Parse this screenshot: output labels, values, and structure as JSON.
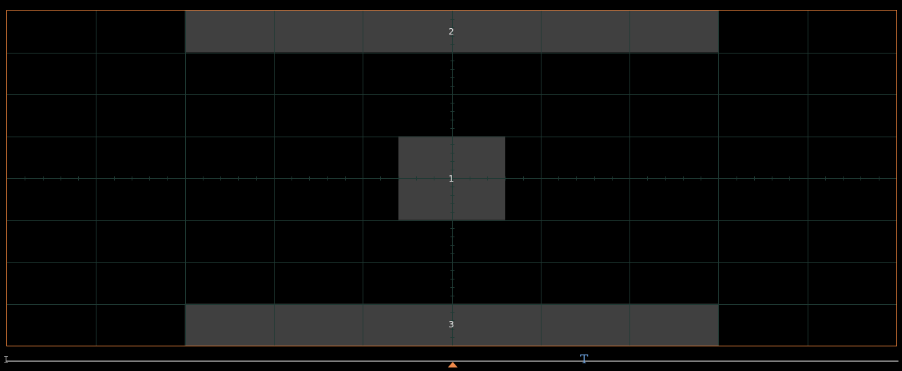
{
  "zones": {
    "zone1": {
      "label": "1"
    },
    "zone2": {
      "label": "2"
    },
    "zone3": {
      "label": "3"
    }
  },
  "timebase": {
    "left_marker": "I",
    "trigger_marker": "T"
  },
  "colors": {
    "border": "#e8803a",
    "grid": "#1f3a34",
    "zone_fill": "#404040",
    "trigger_pos": "#f08a4b",
    "trigger_t": "#6fa8e8"
  },
  "icons": {
    "trigger_position": "triangle-up-icon",
    "trigger_time": "t-marker-icon",
    "left_limit": "i-beam-icon"
  }
}
